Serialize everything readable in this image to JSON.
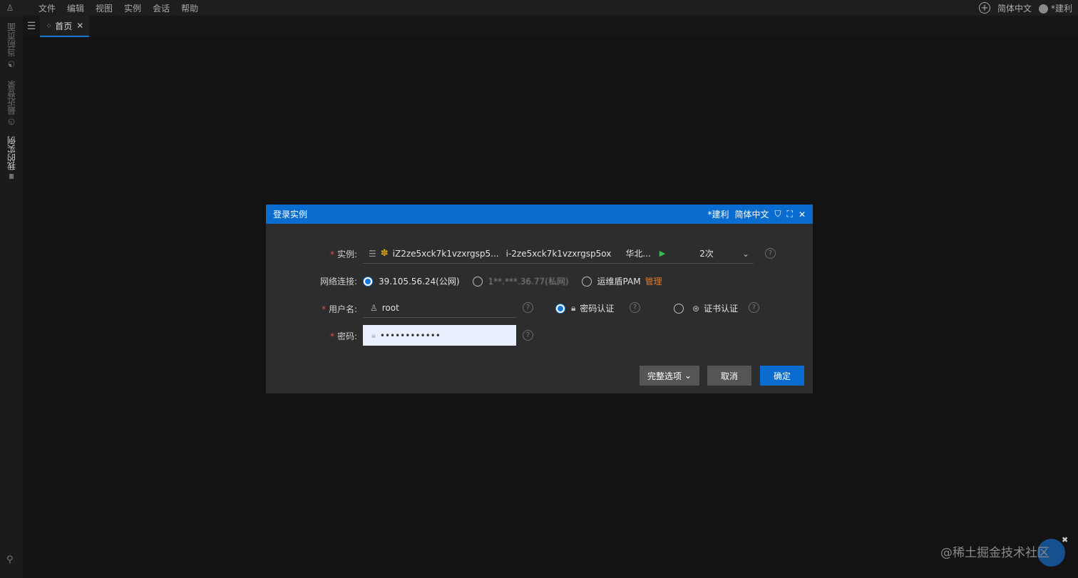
{
  "menubar": {
    "items": [
      "文件",
      "编辑",
      "视图",
      "实例",
      "会话",
      "帮助"
    ],
    "language": "简体中文",
    "user": "*建利"
  },
  "sidebar": {
    "tabs": [
      "当前页面",
      "最近登录",
      "我的实例"
    ]
  },
  "tabs": [
    {
      "label": "首页",
      "active": true
    }
  ],
  "dialog": {
    "title": "登录实例",
    "user": "*建利",
    "language": "简体中文",
    "instance": {
      "label": "实例:",
      "name": "iZ2ze5xck7k1vzxrgsp5...",
      "id": "i-2ze5xck7k1vzxrgsp5ox",
      "region": "华北...",
      "count": "2次"
    },
    "network": {
      "label": "网络连接:",
      "public": "39.105.56.24(公网)",
      "private": "1**.***.36.77(私网)",
      "pam": "运维盾PAM",
      "manage": "管理"
    },
    "username": {
      "label": "用户名:",
      "value": "root"
    },
    "auth": {
      "password": "密码认证",
      "cert": "证书认证"
    },
    "password": {
      "label": "密码:",
      "value": "••••••••••••"
    },
    "buttons": {
      "options": "完整选项",
      "cancel": "取消",
      "confirm": "确定"
    }
  },
  "watermark": "@稀土掘金技术社区",
  "colors": {
    "accent": "#0a6ccf",
    "required": "#e34b4b",
    "link": "#e07a2f"
  }
}
